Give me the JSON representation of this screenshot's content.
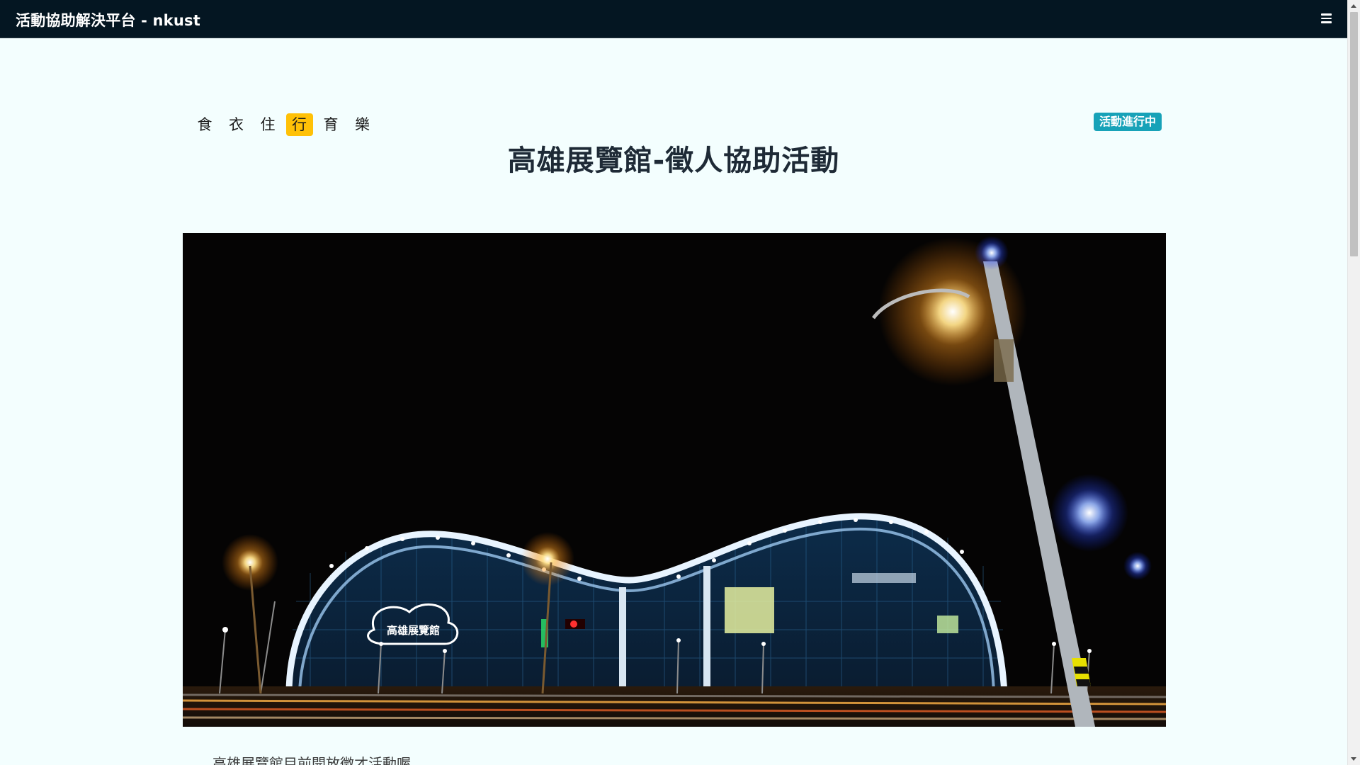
{
  "navbar": {
    "brand": "活動協助解決平台 - nkust",
    "menu_icon": "hamburger-menu-icon"
  },
  "categories": [
    {
      "label": "食",
      "active": false
    },
    {
      "label": "衣",
      "active": false
    },
    {
      "label": "住",
      "active": false
    },
    {
      "label": "行",
      "active": true
    },
    {
      "label": "育",
      "active": false
    },
    {
      "label": "樂",
      "active": false
    }
  ],
  "status_badge": "活動進行中",
  "title": "高雄展覽館-徵人協助活動",
  "hero_image": {
    "sign_text": "高雄展覽館"
  },
  "description": "高雄展覽館目前開放徵才活動喔",
  "colors": {
    "navbar_bg": "#041622",
    "page_bg": "#f3fefe",
    "active_category": "#ffc107",
    "badge": "#17a2b8"
  }
}
